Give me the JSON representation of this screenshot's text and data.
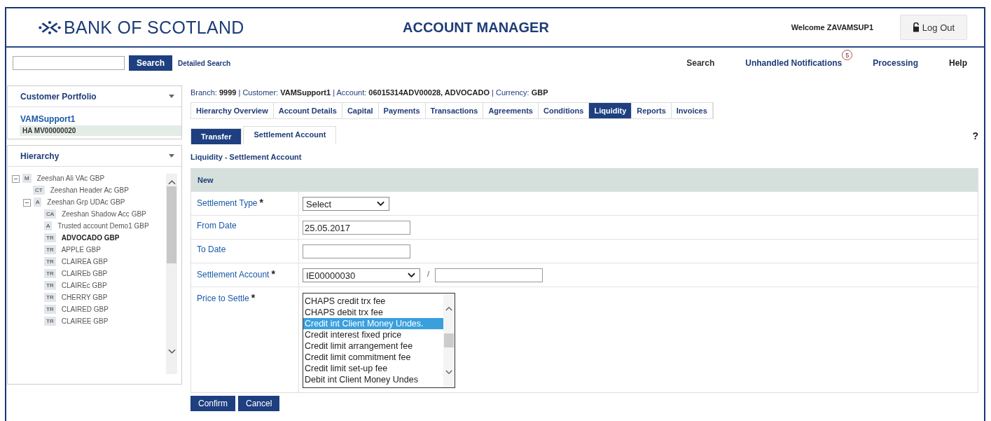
{
  "header": {
    "logo": "BANK OF SCOTLAND",
    "title": "ACCOUNT MANAGER",
    "welcome": "Welcome ZAVAMSUP1",
    "logout": "Log Out"
  },
  "toolbar": {
    "search_button": "Search",
    "detailed_search": "Detailed Search",
    "links": [
      {
        "label": "Search"
      },
      {
        "label": "Unhandled Notifications",
        "badge": "5"
      },
      {
        "label": "Processing"
      },
      {
        "label": "Help"
      }
    ]
  },
  "sidebar": {
    "portfolio": {
      "title": "Customer Portfolio",
      "customer": "VAMSupport1",
      "account": "HA MV00000020"
    },
    "hierarchy": {
      "title": "Hierarchy",
      "tree": [
        {
          "type": "M",
          "label": "Zeeshan Ali VAc GBP",
          "expanded": true,
          "selected": false,
          "children": [
            {
              "type": "CT",
              "label": "Zeeshan Header Ac GBP",
              "selected": false
            },
            {
              "type": "A",
              "label": "Zeeshan Grp UDAc GBP",
              "expanded": true,
              "selected": false,
              "children": [
                {
                  "type": "CA",
                  "label": "Zeeshan Shadow Acc GBP",
                  "selected": false
                },
                {
                  "type": "A",
                  "label": "Trusted account Demo1 GBP",
                  "selected": false
                },
                {
                  "type": "TR",
                  "label": "ADVOCADO GBP",
                  "selected": true
                },
                {
                  "type": "TR",
                  "label": "APPLE GBP",
                  "selected": false
                },
                {
                  "type": "TR",
                  "label": "CLAIREA GBP",
                  "selected": false
                },
                {
                  "type": "TR",
                  "label": "CLAIREb GBP",
                  "selected": false
                },
                {
                  "type": "TR",
                  "label": "CLAIREc GBP",
                  "selected": false
                },
                {
                  "type": "TR",
                  "label": "CHERRY GBP",
                  "selected": false
                },
                {
                  "type": "TR",
                  "label": "CLAIRED GBP",
                  "selected": false
                },
                {
                  "type": "TR",
                  "label": "CLAIREE GBP",
                  "selected": false
                }
              ]
            }
          ]
        }
      ]
    }
  },
  "main": {
    "breadcrumb": "Branch: **9999** | Customer: **VAMSupport1** | Account: **06015314ADV00028, ADVOCADO** | Currency: **GBP**",
    "tabs": [
      {
        "label": "Hierarchy Overview",
        "selected": false
      },
      {
        "label": "Account Details",
        "selected": false
      },
      {
        "label": "Capital",
        "selected": false
      },
      {
        "label": "Payments",
        "selected": false
      },
      {
        "label": "Transactions",
        "selected": false
      },
      {
        "label": "Agreements",
        "selected": false
      },
      {
        "label": "Conditions",
        "selected": false
      },
      {
        "label": "Liquidity",
        "selected": true
      },
      {
        "label": "Reports",
        "selected": false
      },
      {
        "label": "Invoices",
        "selected": false
      }
    ],
    "subtabs": [
      {
        "label": "Transfer",
        "selected": false
      },
      {
        "label": "Settlement Account",
        "selected": true
      }
    ],
    "help": "?",
    "heading": "Liquidity - Settlement Account",
    "form": {
      "section": "New",
      "fields": [
        {
          "kind": "select",
          "label": "Settlement Type",
          "mark": "*",
          "value": "Select"
        },
        {
          "kind": "text",
          "label": "From Date",
          "value": "25.05.2017"
        },
        {
          "kind": "text",
          "label": "To Date"
        },
        {
          "kind": "select_text",
          "label": "Settlement Account",
          "mark": "*",
          "value": "IE00000030",
          "separator": "/"
        },
        {
          "kind": "listbox",
          "label": "Price to Settle",
          "mark": "*",
          "options": [
            {
              "label": "CHAPS credit trx fee",
              "selected": false
            },
            {
              "label": "CHAPS debit trx fee",
              "selected": false
            },
            {
              "label": "Credit int Client Money Undes.",
              "selected": true
            },
            {
              "label": "Credit interest fixed price",
              "selected": false
            },
            {
              "label": "Credit limit arrangement fee",
              "selected": false
            },
            {
              "label": "Credit limit commitment fee",
              "selected": false
            },
            {
              "label": "Credit limit set-up fee",
              "selected": false
            },
            {
              "label": "Debit int Client Money Undes",
              "selected": false
            }
          ]
        }
      ]
    },
    "buttons": [
      "Confirm",
      "Cancel"
    ]
  }
}
